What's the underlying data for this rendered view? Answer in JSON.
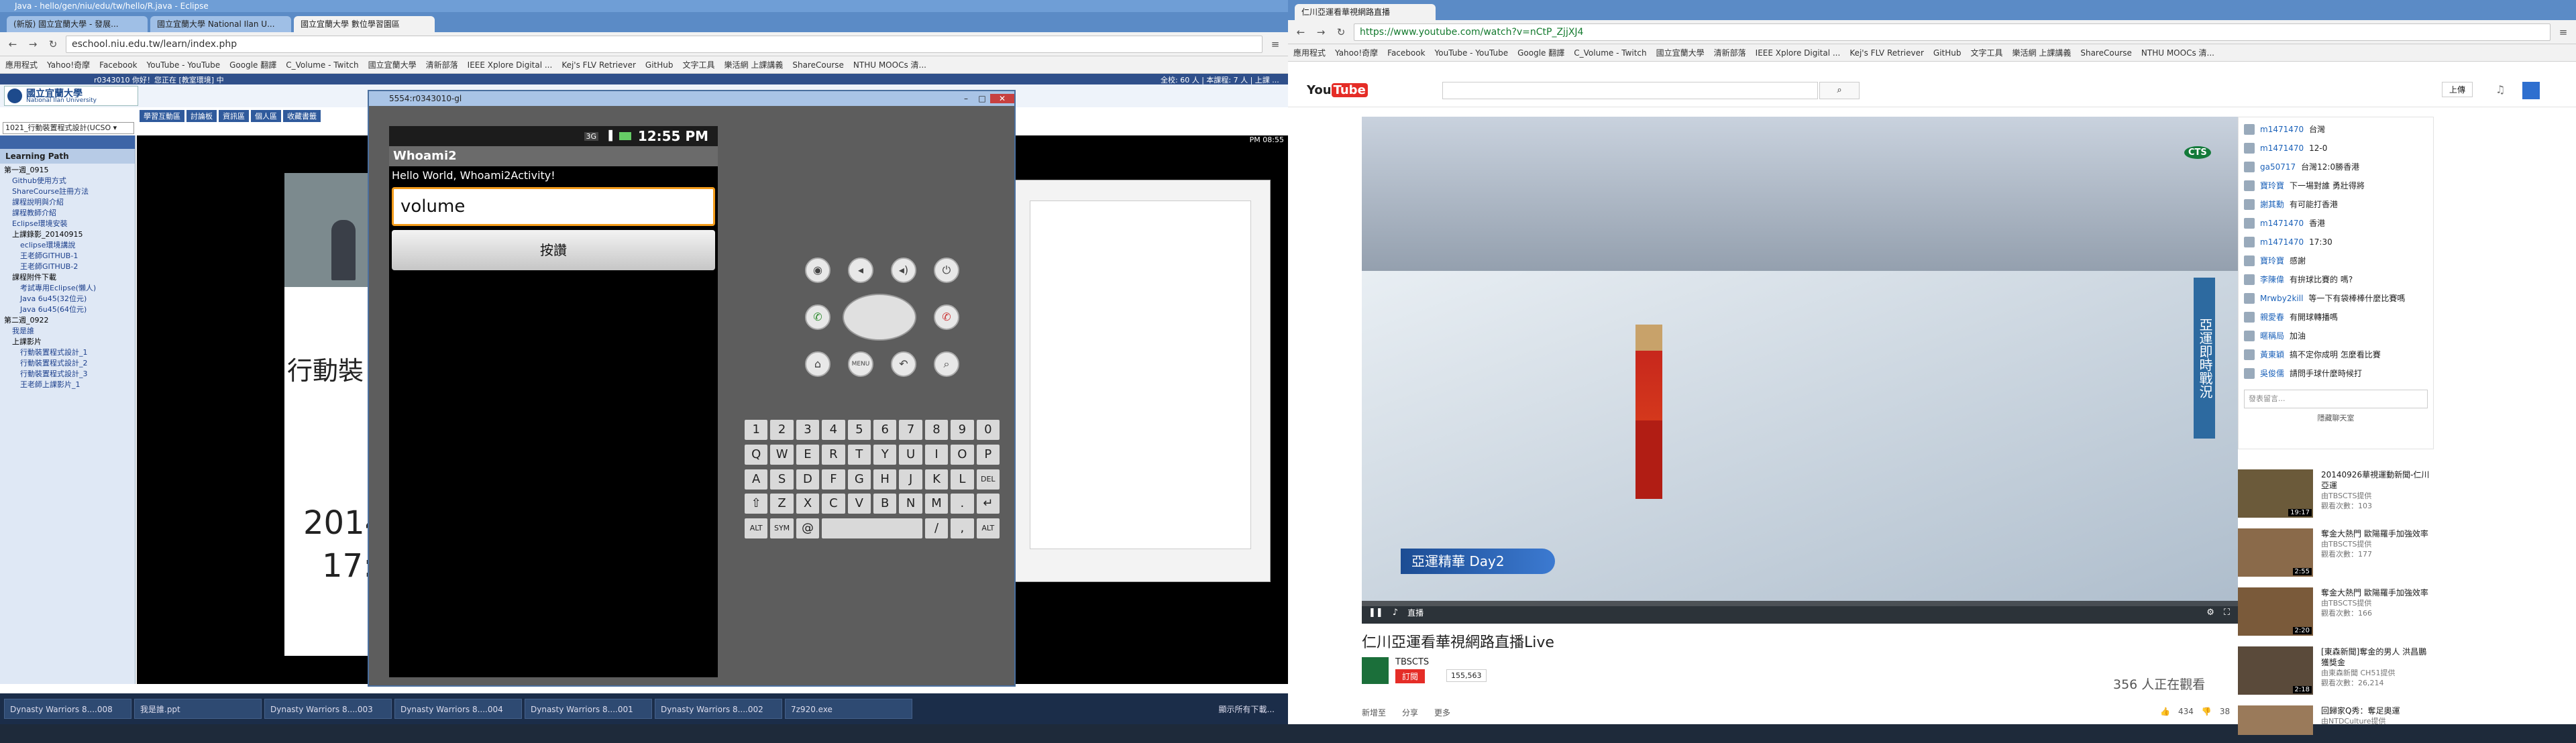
{
  "left_window": {
    "title": "Java - hello/gen/niu/edu/tw/hello/R.java - Eclipse",
    "tabs": [
      "(新版) 國立宜蘭大學 - 發展...",
      "國立宜蘭大學 National Ilan U...",
      "國立宜蘭大學 數位學習園區"
    ],
    "url": "eschool.niu.edu.tw/learn/index.php",
    "bookmarks": [
      "應用程式",
      "Yahoo!奇摩",
      "Facebook",
      "YouTube - YouTube",
      "Google 翻譯",
      "C_Volume - Twitch",
      "國立宜蘭大學",
      "清新部落",
      "IEEE Xplore Digital ...",
      "Kej's FLV Retriever",
      "GitHub",
      "文字工具",
      "樂活網 上課講義",
      "ShareCourse",
      "NTHU MOOCs 清..."
    ]
  },
  "eschool": {
    "logo": "國立宜蘭大學",
    "logo_en": "National Ilan University",
    "user": "r0343010 你好！您正在 [教室環境] 中",
    "course_select": "1021_行動裝置程式設計(UCSO ▾",
    "nav": [
      "學習互動區",
      "討論板",
      "資訊區",
      "個人區",
      "收藏書籤"
    ],
    "stats": "全校: 60 人 | 本課程: 7 人 | 上課 ...",
    "learning_path_title": "Learning Path",
    "tree": [
      "第一週_0915",
      "Github使用方式",
      "ShareCourse註冊方法",
      "課程說明與介紹",
      "課程教師介紹",
      "Eclipse環境安裝",
      "上課錄影_20140915",
      "eclipse環境講說",
      "王老師GITHUB-1",
      "王老師GITHUB-2",
      "課程附件下載",
      "考試專用Eclipse(懶人)",
      "Java 6u45(32位元)",
      "Java 6u45(64位元)",
      "第二週_0922",
      "我是誰",
      "上課影片",
      "行動裝置程式設計_1",
      "行動裝置程式設計_2",
      "行動裝置程式設計_3",
      "王老師上課影片_1"
    ],
    "slide_title": "行動裝",
    "slide_year": "2014",
    "slide_time": "17:",
    "clock": "PM 08:55"
  },
  "emulator": {
    "window_title": "5554:r0343010-gl",
    "time": "12:55 PM",
    "app_title": "Whoami2",
    "hello": "Hello World, Whoami2Activity!",
    "input_value": "volume",
    "button_label": "按讚",
    "keyboard_rows": [
      [
        "1",
        "2",
        "3",
        "4",
        "5",
        "6",
        "7",
        "8",
        "9",
        "0"
      ],
      [
        "Q",
        "W",
        "E",
        "R",
        "T",
        "Y",
        "U",
        "I",
        "O",
        "P"
      ],
      [
        "A",
        "S",
        "D",
        "F",
        "G",
        "H",
        "J",
        "K",
        "L",
        "DEL"
      ],
      [
        "⇧",
        "Z",
        "X",
        "C",
        "V",
        "B",
        "N",
        "M",
        ".",
        "↵"
      ],
      [
        "ALT",
        "SYM",
        "@",
        "",
        "",
        "",
        "",
        "/",
        ",",
        "ALT"
      ]
    ],
    "menu_key": "MENU"
  },
  "taskbar": {
    "items": [
      "Dynasty Warriors 8....008",
      "我是誰.ppt",
      "Dynasty Warriors 8....003",
      "Dynasty Warriors 8....004",
      "Dynasty Warriors 8....001",
      "Dynasty Warriors 8....002",
      "7z920.exe"
    ],
    "more": "顯示所有下載..."
  },
  "right_window": {
    "tab": "仁川亞運看華視網路直播",
    "url": "https://www.youtube.com/watch?v=nCtP_ZjjXJ4",
    "bookmarks": [
      "應用程式",
      "Yahoo!奇摩",
      "Facebook",
      "YouTube - YouTube",
      "Google 翻譯",
      "C_Volume - Twitch",
      "國立宜蘭大學",
      "清新部落",
      "IEEE Xplore Digital ...",
      "Kej's FLV Retriever",
      "GitHub",
      "文字工具",
      "樂活網 上課講義",
      "ShareCourse",
      "NTHU MOOCs 清..."
    ],
    "upload": "上傳"
  },
  "video": {
    "banner_text": "亞運精華 Day2",
    "side_banner": "亞運即時戰況",
    "logo": "CTS",
    "live_label": "直播",
    "title": "仁川亞運看華視網路直播Live",
    "channel": "TBSCTS",
    "subscribe": "訂閱",
    "sub_count": "155,563",
    "viewers": "356 人正在觀看",
    "actions": [
      "新增至",
      "分享",
      "更多"
    ],
    "likes": "434",
    "dislikes": "38"
  },
  "chat": {
    "messages": [
      [
        "m1471470",
        "台灣"
      ],
      [
        "m1471470",
        "12-0"
      ],
      [
        "ga50717",
        "台灣12:0勝香港"
      ],
      [
        "寶玲寶",
        "下一場對誰 勇壯得將"
      ],
      [
        "謝其勳",
        "有可能打香港"
      ],
      [
        "m1471470",
        "香港"
      ],
      [
        "m1471470",
        "17:30"
      ],
      [
        "寶玲寶",
        "感謝"
      ],
      [
        "李陳偉",
        "有拚球比賽的 嗎?"
      ],
      [
        "Mrwby2kill",
        "等一下有袋棒棒什麼比賽嗎"
      ],
      [
        "親愛春",
        "有開球轉播嗎"
      ],
      [
        "暱稱局",
        "加油"
      ],
      [
        "黃東穎",
        "搞不定你成明 怎麼看比賽"
      ],
      [
        "吳俊儒",
        "請問手球什麼時候打"
      ]
    ],
    "placeholder": "發表留言...",
    "hide": "隱藏聊天室"
  },
  "related": [
    {
      "title": "20140926華視運動新聞-仁川亞運",
      "meta": "由TBSCTS提供",
      "views": "觀看次數：103",
      "dur": "19:17"
    },
    {
      "title": "奪金大熱門 歐陽羅手加強效率",
      "meta": "由TBSCTS提供",
      "views": "觀看次數：177",
      "dur": "2:55"
    },
    {
      "title": "奪金大熱門 歐陽羅手加強效率",
      "meta": "由TBSCTS提供",
      "views": "觀看次數：166",
      "dur": "2:20"
    },
    {
      "title": "[東森新聞]奪金的男人 洪昌鵬獲獎金",
      "meta": "由東森新聞 CH51提供",
      "views": "觀看次數：26,214",
      "dur": "2:18"
    },
    {
      "title": "回歸家Q秀：奪足奧運",
      "meta": "由NTDCulture提供",
      "views": "",
      "dur": ""
    }
  ]
}
